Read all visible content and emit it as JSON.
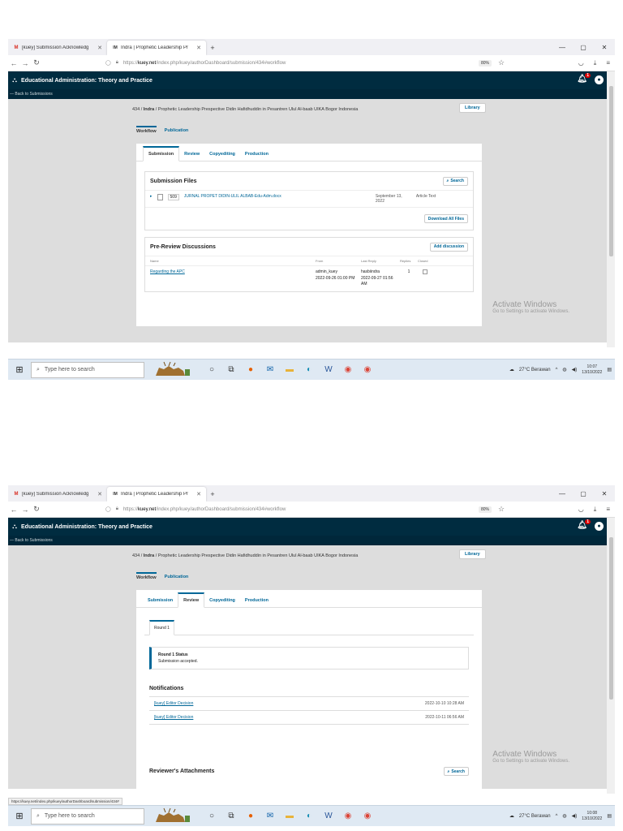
{
  "browser": {
    "tabs": [
      {
        "icon": "M",
        "title": "[kuey] Submission Acknowledg",
        "active": false
      },
      {
        "icon": "IM",
        "title": "Indra | Prophetic Leadership Pr",
        "active": true
      }
    ],
    "url_prefix": "https://",
    "url_domain": "kuey.net",
    "url_path": "/index.php/kuey/authorDashboard/submission/434#workflow",
    "zoom": "80%"
  },
  "app": {
    "site_title": "Educational Administration: Theory and Practice",
    "back_link": "— Back to Submissions",
    "notif_count": "1",
    "breadcrumb_id": "434",
    "breadcrumb_author": "Indra",
    "breadcrumb_title": "Prophetic Leadership Prespective Didin Hafidhuddin in Pesantren Ulul Al-baab UIKA Bogor Indonesia",
    "library_label": "Library",
    "main_tabs": [
      "Workflow",
      "Publication"
    ],
    "stage_tabs": [
      "Submission",
      "Review",
      "Copyediting",
      "Production"
    ]
  },
  "shot1": {
    "files_title": "Submission Files",
    "search_label": "Search",
    "file_id": "509",
    "file_name": "JURNAL PROPET DIDIN-ULIL ALBAB-Edu-Adm.docx",
    "file_date": "September 13, 2022",
    "file_type": "Article Text",
    "download_label": "Download All Files",
    "discussions_title": "Pre-Review Discussions",
    "add_discussion_label": "Add discussion",
    "columns": [
      "Name",
      "From",
      "Last Reply",
      "Replies",
      "Closed"
    ],
    "discussion": {
      "name": "Regarding the APC",
      "from": "admin_kuey",
      "from_date": "2022-09-26 01:00 PM",
      "reply_user": "hasbiindra",
      "reply_date": "2022-09-27 01:56 AM",
      "replies": "1"
    },
    "clock_time": "10:07",
    "clock_date": "13/10/2022"
  },
  "shot2": {
    "round_tab": "Round 1",
    "status_title": "Round 1 Status",
    "status_text": "Submission accepted.",
    "notifications_title": "Notifications",
    "notifications": [
      {
        "label": "[kuey] Editor Decision",
        "date": "2022-10-10 10:28 AM"
      },
      {
        "label": "[kuey] Editor Decision",
        "date": "2022-10-11 06:56 AM"
      }
    ],
    "attachments_title": "Reviewer's Attachments",
    "search_label": "Search",
    "status_url": "https://kuey.net/index.php/kuey/authorDashboard/submission/434#",
    "clock_time": "10:08",
    "clock_date": "13/10/2022"
  },
  "watermark": {
    "line1": "Activate Windows",
    "line2": "Go to Settings to activate Windows."
  },
  "taskbar": {
    "search_placeholder": "Type here to search",
    "weather": "27°C  Berawan"
  },
  "colors": {
    "header": "#002c40",
    "accent": "#006798",
    "body_bg": "#dddddd"
  }
}
